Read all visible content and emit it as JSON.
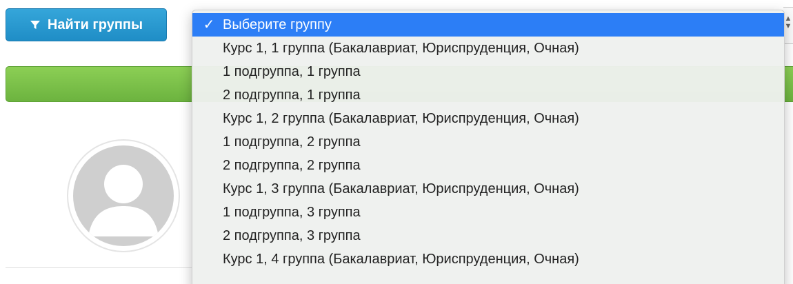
{
  "toolbar": {
    "find_button_label": "Найти группы",
    "find_button_icon": "filter-icon"
  },
  "group_select": {
    "selected_check": "✓",
    "options": [
      "Выберите группу",
      "Курс 1, 1 группа (Бакалавриат, Юриспруденция, Очная)",
      "1 подгруппа, 1 группа",
      "2 подгруппа, 1 группа",
      "Курс 1, 2 группа (Бакалавриат, Юриспруденция, Очная)",
      "1 подгруппа, 2 группа",
      "2 подгруппа, 2 группа",
      "Курс 1, 3 группа (Бакалавриат, Юриспруденция, Очная)",
      "1 подгруппа, 3 группа",
      "2 подгруппа, 3 группа",
      "Курс 1, 4 группа (Бакалавриат, Юриспруденция, Очная)"
    ],
    "selected_index": 0
  },
  "colors": {
    "button_blue": "#2a9ad3",
    "bar_green": "#7cc14b",
    "highlight_blue": "#2c7ef6",
    "avatar_gray": "#cfcfcf"
  },
  "avatar": {
    "icon": "user-silhouette-icon"
  }
}
